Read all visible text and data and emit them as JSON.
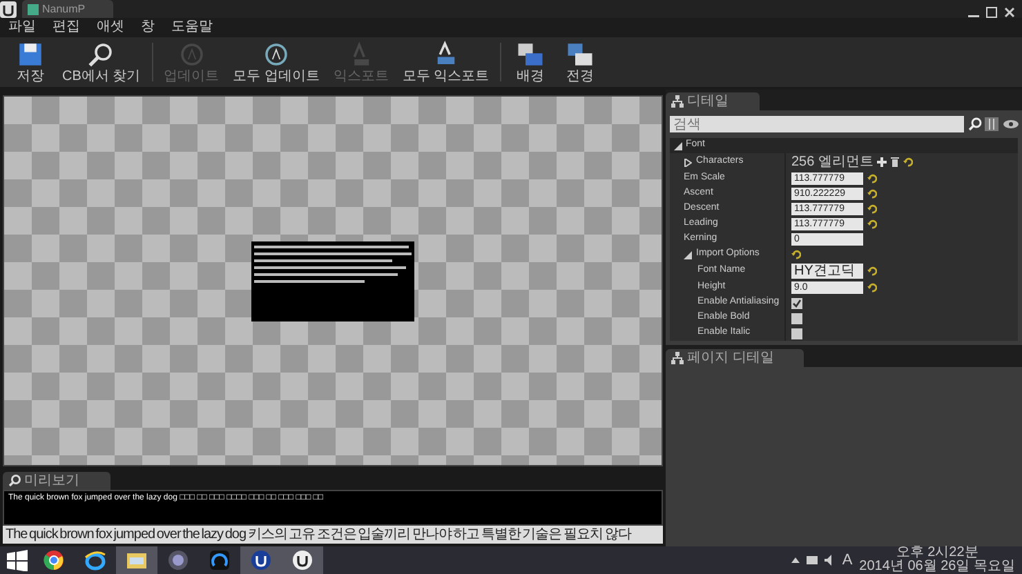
{
  "window": {
    "tab": "NanumP"
  },
  "menu": [
    "파일",
    "편집",
    "애셋",
    "창",
    "도움말"
  ],
  "toolbar": [
    {
      "label": "저장",
      "disabled": false
    },
    {
      "label": "CB에서 찾기",
      "disabled": false
    },
    {
      "label": "업데이트",
      "disabled": true
    },
    {
      "label": "모두 업데이트",
      "disabled": false
    },
    {
      "label": "익스포트",
      "disabled": true
    },
    {
      "label": "모두 익스포트",
      "disabled": false
    },
    {
      "label": "배경",
      "disabled": false
    },
    {
      "label": "전경",
      "disabled": false
    }
  ],
  "details": {
    "tab": "디테일",
    "search": {
      "placeholder": "검색"
    },
    "properties": [
      {
        "kind": "section",
        "label": "Font",
        "expanded": true,
        "children": [
          {
            "kind": "array",
            "label": "Characters",
            "expanded": false,
            "value": "256 엘리먼트",
            "reset": true
          },
          {
            "kind": "number",
            "label": "Em Scale",
            "value": "113.777779",
            "reset": true
          },
          {
            "kind": "number",
            "label": "Ascent",
            "value": "910.222229",
            "reset": true
          },
          {
            "kind": "number",
            "label": "Descent",
            "value": "113.777779",
            "reset": true
          },
          {
            "kind": "number",
            "label": "Leading",
            "value": "113.777779",
            "reset": true
          },
          {
            "kind": "number",
            "label": "Kerning",
            "value": "0",
            "reset": false
          },
          {
            "kind": "section",
            "label": "Import Options",
            "expanded": true,
            "reset": true,
            "children": [
              {
                "kind": "text",
                "label": "Font Name",
                "value": "HY견고딕",
                "reset": true
              },
              {
                "kind": "number",
                "label": "Height",
                "value": "9.0",
                "reset": true
              },
              {
                "kind": "check",
                "label": "Enable Antialiasing",
                "checked": true
              },
              {
                "kind": "check",
                "label": "Enable Bold",
                "checked": false
              },
              {
                "kind": "check",
                "label": "Enable Italic",
                "checked": false
              }
            ]
          }
        ]
      }
    ]
  },
  "page_details": {
    "tab": "페이지 디테일"
  },
  "preview": {
    "tab": "미리보기",
    "sample": "The quick brown fox jumped over the lazy dog □□□ □□ □□□ □□□□ □□□ □□ □□□ □□□ □□",
    "input": "The quick brown fox jumped over the lazy dog 키스의 고유 조건은 입술끼리 만나야 하고 특별한 기술은 필요치 않다"
  },
  "taskbar": {
    "apps": [
      {
        "active": false
      },
      {
        "active": false
      },
      {
        "active": true
      },
      {
        "active": false
      },
      {
        "active": false
      },
      {
        "active": true
      },
      {
        "active": true
      }
    ],
    "ime": "A",
    "time": "오후 2시22분",
    "date": "2014년 06월 26일 목요일"
  }
}
